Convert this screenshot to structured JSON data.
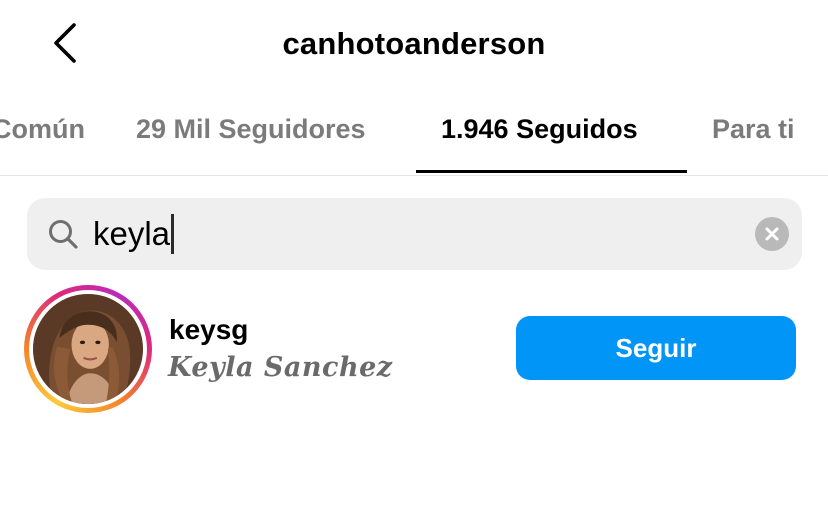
{
  "header": {
    "title": "canhotoanderson",
    "back_icon": "chevron-left-icon"
  },
  "tabs": [
    {
      "label": "Común",
      "active": false
    },
    {
      "label": "29 Mil Seguidores",
      "active": false
    },
    {
      "label": "1.946 Seguidos",
      "active": true
    },
    {
      "label": "Para ti",
      "active": false
    }
  ],
  "search": {
    "value": "keyla",
    "icon": "search-icon",
    "clear_icon": "clear-icon"
  },
  "results": [
    {
      "username": "keysg",
      "full_name": "Keyla Sanchez",
      "has_story_ring": true,
      "action_label": "Seguir"
    }
  ],
  "colors": {
    "accent": "#0095f6",
    "inactive_tab": "#7b7b7b",
    "search_bg": "#efefef"
  }
}
